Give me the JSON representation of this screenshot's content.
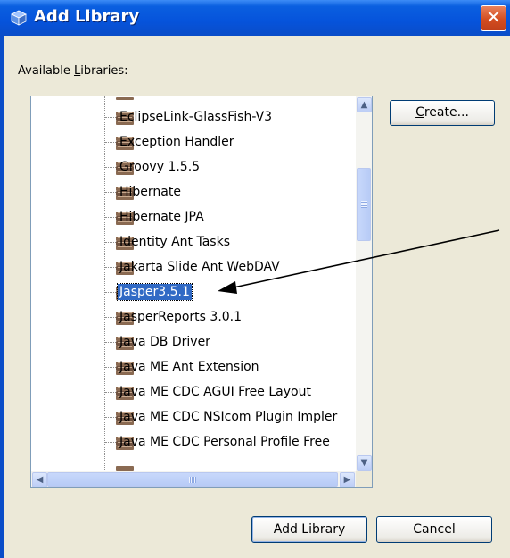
{
  "window": {
    "title": "Add Library",
    "close_glyph": "✕"
  },
  "available_label_prefix": "Available ",
  "available_label_mnemonic": "L",
  "available_label_suffix": "ibraries:",
  "libraries": [
    {
      "label": "EclipseLink-GlassFish-V3",
      "selected": false
    },
    {
      "label": "Exception Handler",
      "selected": false
    },
    {
      "label": "Groovy 1.5.5",
      "selected": false
    },
    {
      "label": "Hibernate",
      "selected": false
    },
    {
      "label": "Hibernate JPA",
      "selected": false
    },
    {
      "label": "Identity Ant Tasks",
      "selected": false
    },
    {
      "label": "Jakarta Slide Ant WebDAV",
      "selected": false
    },
    {
      "label": "Jasper3.5.1",
      "selected": true
    },
    {
      "label": "JasperReports 3.0.1",
      "selected": false
    },
    {
      "label": "Java DB Driver",
      "selected": false
    },
    {
      "label": "Java ME Ant Extension",
      "selected": false
    },
    {
      "label": "Java ME CDC AGUI Free Layout",
      "selected": false
    },
    {
      "label": "Java ME CDC NSIcom Plugin Impler",
      "selected": false
    },
    {
      "label": "Java ME CDC Personal Profile Free",
      "selected": false
    }
  ],
  "scrollbar": {
    "up_glyph": "▲",
    "down_glyph": "▼",
    "left_glyph": "◀",
    "right_glyph": "▶"
  },
  "buttons": {
    "create": "Create...",
    "add_library": "Add Library",
    "cancel": "Cancel"
  },
  "colors": {
    "title_bar": "#0a5fe0",
    "selection": "#316ac5",
    "close_button": "#d34d20"
  }
}
